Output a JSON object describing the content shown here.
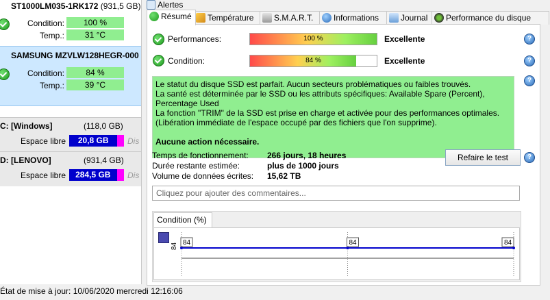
{
  "left_pane": {
    "disks": [
      {
        "name": "ST1000LM035-1RK172",
        "size": "(931,5 GB)",
        "condition_label": "Condition:",
        "condition": "100 %",
        "temp_label": "Temp.:",
        "temp": "31 °C"
      },
      {
        "name": "SAMSUNG MZVLW128HEGR-000",
        "size": "",
        "condition_label": "Condition:",
        "condition": "84 %",
        "temp_label": "Temp.:",
        "temp": "39 °C"
      }
    ],
    "volumes": [
      {
        "name": "C: [Windows]",
        "size": "(118,0 GB)",
        "free_label": "Espace libre",
        "free": "20,8 GB",
        "free_fraction": 0.88,
        "trail": "Dis"
      },
      {
        "name": "D: [LENOVO]",
        "size": "(931,4 GB)",
        "free_label": "Espace libre",
        "free": "284,5 GB",
        "free_fraction": 0.87,
        "trail": "Dis"
      }
    ]
  },
  "alertes": "Alertes",
  "tabs": [
    {
      "label": "Résumé",
      "icon": "green-check-icon",
      "active": true
    },
    {
      "label": "Température",
      "icon": "thermometer-icon",
      "active": false
    },
    {
      "label": "S.M.A.R.T.",
      "icon": "disk-icon",
      "active": false
    },
    {
      "label": "Informations",
      "icon": "info-icon",
      "active": false
    },
    {
      "label": "Journal",
      "icon": "journal-icon",
      "active": false
    },
    {
      "label": "Performance du disque",
      "icon": "performance-icon",
      "active": false
    }
  ],
  "summary": {
    "performances": {
      "label": "Performances:",
      "value": "100 %",
      "fraction": 1.0,
      "rating": "Excellente"
    },
    "condition": {
      "label": "Condition:",
      "value": "84 %",
      "fraction": 0.84,
      "rating": "Excellente"
    },
    "status_lines": [
      "Le statut du disque SSD est parfait. Aucun secteurs problématiques ou faibles trouvés.",
      "La santé est déterminée par le SSD ou les attributs spécifiques: Available Spare (Percent), Percentage Used",
      "La fonction \"TRIM\" de la SSD est prise en charge et activée pour des performances optimales.",
      "(Libération immédiate de l'espace occupé par des fichiers que l'on supprime)."
    ],
    "action": "Aucune action nécessaire.",
    "uptime_label": "Temps de fonctionnement:",
    "uptime": "266 jours, 18 heures",
    "remaining_label": "Durée restante estimée:",
    "remaining": "plus de 1000 jours",
    "written_label": "Volume de données écrites:",
    "written": "15,62 TB",
    "retest_button": "Refaire le test",
    "comments_placeholder": "Cliquez pour ajouter des commentaires..."
  },
  "chart_tab": "Condition (%)",
  "chart_data": {
    "type": "line",
    "x": [
      "",
      "",
      ""
    ],
    "series": [
      {
        "values": [
          84,
          84,
          84
        ]
      }
    ],
    "point_labels": [
      "84",
      "84",
      "84"
    ],
    "y_tick": "84",
    "ylim": [
      83,
      85
    ],
    "line_color": "#0000cc"
  },
  "bottom_status": "État de mise à jour: 10/06/2020 mercredi 12:16:06"
}
